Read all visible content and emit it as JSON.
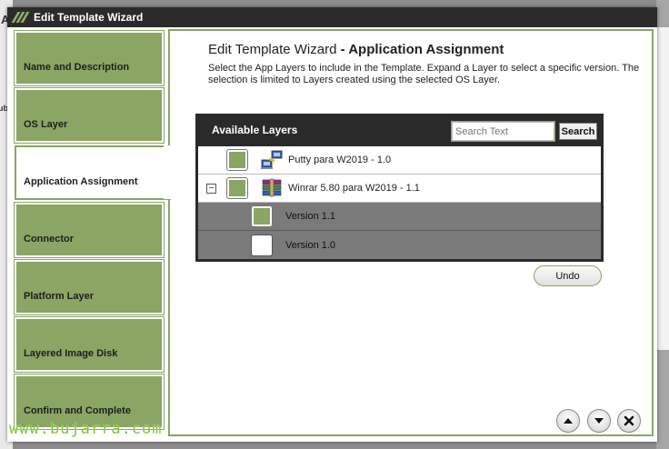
{
  "window": {
    "title": "Edit Template Wizard"
  },
  "background": {
    "fragment_a": "A",
    "fragment_ubl": "ubl"
  },
  "steps": [
    {
      "label": "Name and Description"
    },
    {
      "label": "OS Layer"
    },
    {
      "label": "Application Assignment",
      "active": true
    },
    {
      "label": "Connector"
    },
    {
      "label": "Platform Layer"
    },
    {
      "label": "Layered Image Disk"
    },
    {
      "label": "Confirm and Complete"
    }
  ],
  "heading": {
    "prefix": "Edit Template Wizard",
    "suffix": " - Application Assignment"
  },
  "description": "Select the App Layers to include in the Template. Expand a Layer to select a specific version. The selection is limited to Layers created using the selected OS Layer.",
  "panel": {
    "title": "Available Layers",
    "search_placeholder": "Search Text",
    "search_button": "Search",
    "rows": [
      {
        "label": "Putty para W2019 - 1.0",
        "checked": true,
        "icon": "network-computers-icon"
      },
      {
        "label": "Winrar 5.80 para W2019 - 1.1",
        "checked": true,
        "expanded": true,
        "expander": "−",
        "icon": "winrar-books-icon"
      }
    ],
    "versions": [
      {
        "label": "Version 1.1",
        "checked": true
      },
      {
        "label": "Version 1.0",
        "checked": false
      }
    ]
  },
  "undo_label": "Undo",
  "nav": {
    "up": "up-arrow-icon",
    "down": "down-arrow-icon",
    "close": "close-icon"
  },
  "watermark": "www.bujarra.com",
  "colors": {
    "accent": "#8aa564",
    "titlebar": "#2b2b2b",
    "panel": "#2a2a2a",
    "version_row": "#7a7a7a"
  }
}
